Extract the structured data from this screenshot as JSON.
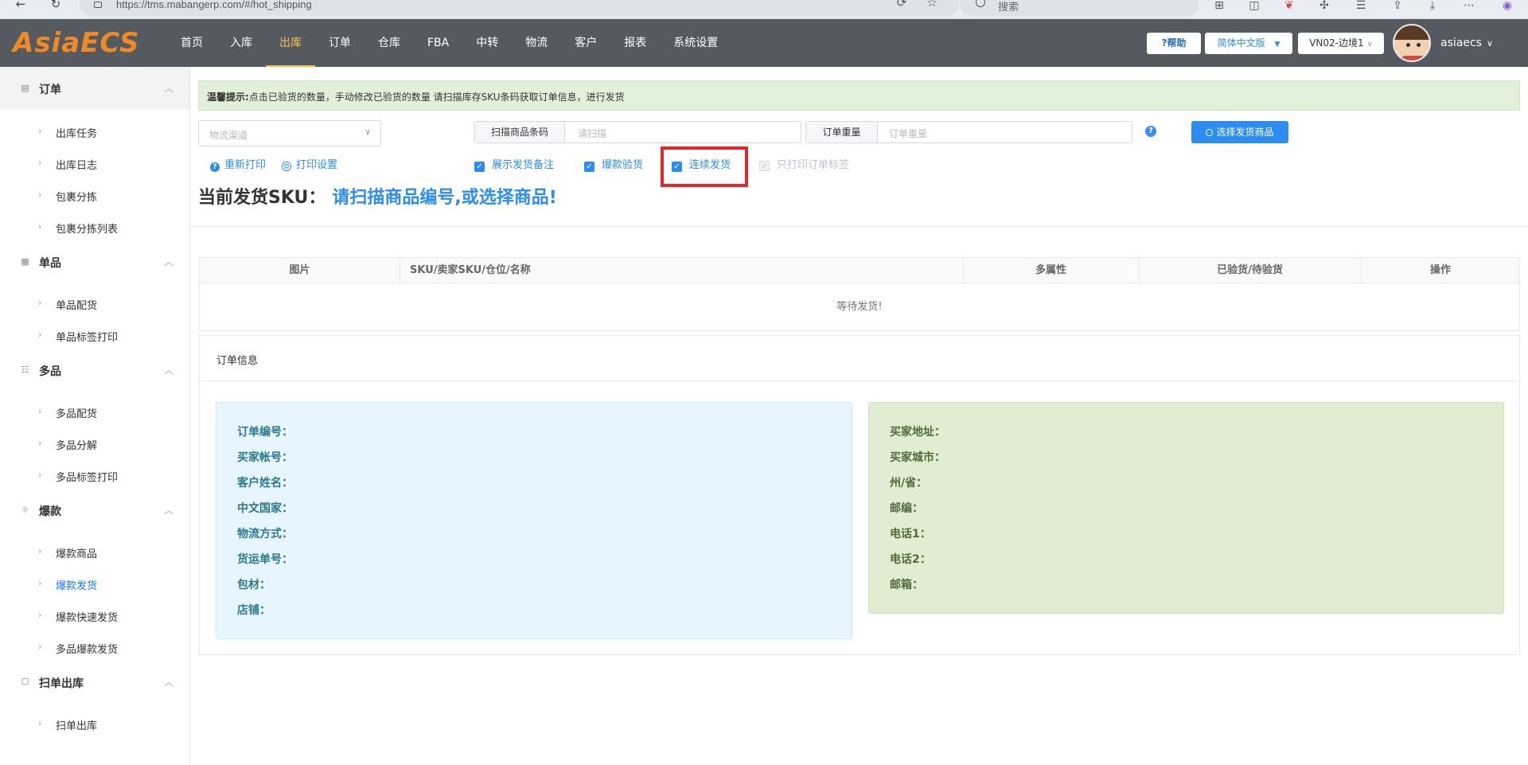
{
  "browser": {
    "url": "https://tms.mabangerp.com/#/hot_shipping",
    "search_placeholder": "搜索"
  },
  "header": {
    "logo": "AsiaECS",
    "nav": [
      "首页",
      "入库",
      "出库",
      "订单",
      "仓库",
      "FBA",
      "中转",
      "物流",
      "客户",
      "报表",
      "系统设置"
    ],
    "active_nav": "出库",
    "help_label": "?帮助",
    "lang_label": "简体中文版",
    "warehouse_label": "VN02-边境1",
    "username": "asiaecs"
  },
  "sidebar": {
    "groups": [
      {
        "label": "订单",
        "icon": "document-icon",
        "items": [
          "出库任务",
          "出库日志",
          "包裹分拣",
          "包裹分拣列表"
        ]
      },
      {
        "label": "单品",
        "icon": "grid-icon",
        "items": [
          "单品配货",
          "单品标签打印"
        ]
      },
      {
        "label": "多品",
        "icon": "list-icon",
        "items": [
          "多品配货",
          "多品分解",
          "多品标签打印"
        ]
      },
      {
        "label": "爆款",
        "icon": "sun-icon",
        "items": [
          "爆款商品",
          "爆款发货",
          "爆款快速发货",
          "多品爆款发货"
        ]
      },
      {
        "label": "扫单出库",
        "icon": "box-icon",
        "items": [
          "扫单出库"
        ]
      }
    ],
    "active_item": "爆款发货"
  },
  "notice": {
    "prefix": "温馨提示:",
    "text": "点击已验货的数量，手动修改已验货的数量 请扫描库存SKU条码获取订单信息，进行发货"
  },
  "toolbar": {
    "channel_placeholder": "物流渠道",
    "scan_addon": "扫描商品条码",
    "scan_placeholder": "请扫描",
    "weight_addon": "订单重量",
    "weight_placeholder": "订单重量",
    "choose_button": "选择发货商品",
    "reprint": "重新打印",
    "print_settings": "打印设置",
    "checkboxes": [
      {
        "label": "展示发货备注",
        "checked": true,
        "disabled": false
      },
      {
        "label": "爆款验货",
        "checked": true,
        "disabled": false
      },
      {
        "label": "连续发货",
        "checked": true,
        "disabled": false
      },
      {
        "label": "只打印订单标签",
        "checked": true,
        "disabled": true
      }
    ]
  },
  "current_sku": {
    "label": "当前发货SKU：",
    "hint": "请扫描商品编号,或选择商品!"
  },
  "table": {
    "columns": [
      "图片",
      "SKU/卖家SKU/仓位/名称",
      "多属性",
      "已验货/待验货",
      "操作"
    ],
    "empty_text": "等待发货!"
  },
  "order_info": {
    "title": "订单信息",
    "left_fields": [
      "订单编号：",
      "买家帐号：",
      "客户姓名：",
      "中文国家：",
      "物流方式：",
      "货运单号：",
      "包材：",
      "店铺："
    ],
    "right_fields": [
      "买家地址：",
      "买家城市：",
      "州/省：",
      "邮编：",
      "电话1：",
      "电话2：",
      "邮箱："
    ]
  },
  "colors": {
    "header_bg": "#555a61",
    "accent": "#2d8cf0",
    "logo": "#f08a24",
    "highlight": "#e5262d"
  }
}
